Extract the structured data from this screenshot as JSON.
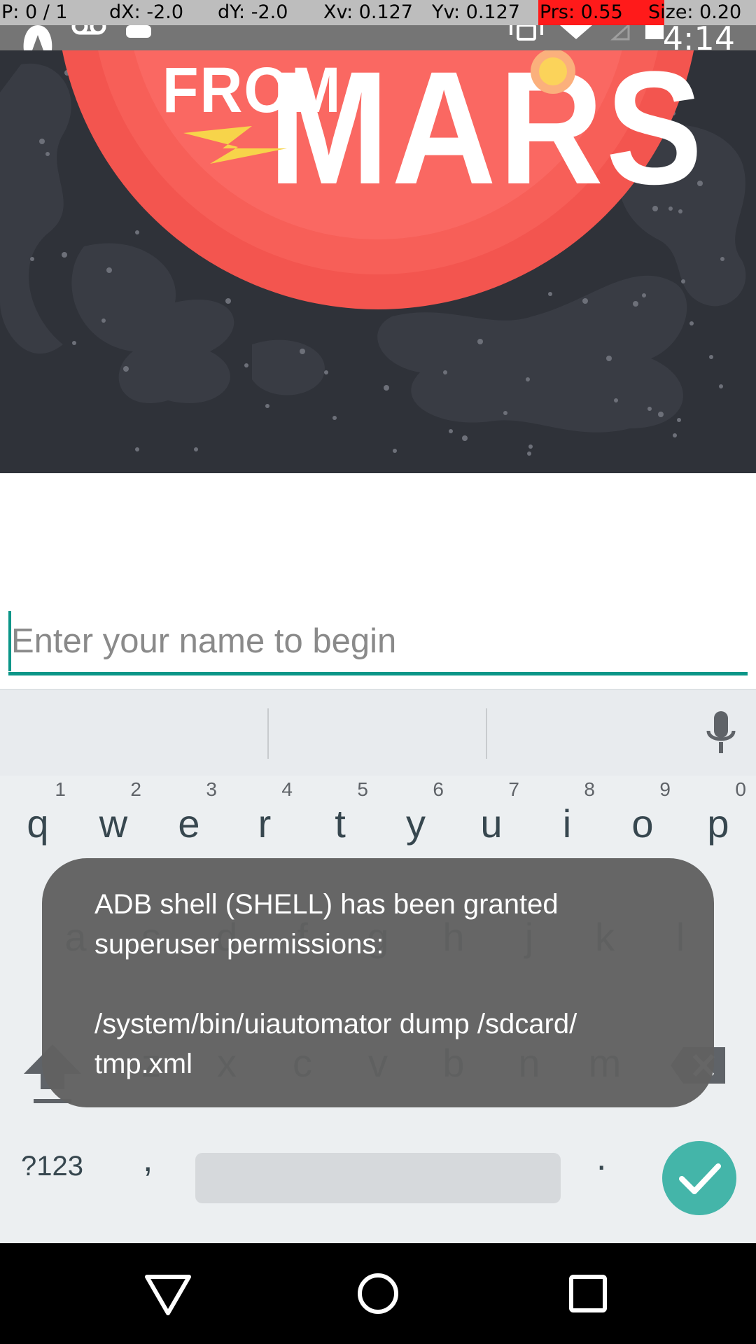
{
  "debug_overlay": {
    "pointer": "P: 0 / 1",
    "dx": "dX: -2.0",
    "dy": "dY: -2.0",
    "xv": "Xv: 0.127",
    "yv": "Yv: 0.127",
    "pressure": "Prs: 0.55",
    "size": "Size: 0.20"
  },
  "status_bar": {
    "time": "4:14",
    "icons": [
      "app-notification-icon",
      "voicemail-icon",
      "android-icon",
      "vibrate-icon",
      "wifi-icon",
      "cell-signal-icon",
      "battery-charging-icon"
    ]
  },
  "hero": {
    "logo_text_small": "FROM",
    "logo_text_large": "MARS"
  },
  "name_input": {
    "placeholder": "Enter your name to begin",
    "value": ""
  },
  "keyboard": {
    "row1": [
      {
        "key": "q",
        "hint": "1"
      },
      {
        "key": "w",
        "hint": "2"
      },
      {
        "key": "e",
        "hint": "3"
      },
      {
        "key": "r",
        "hint": "4"
      },
      {
        "key": "t",
        "hint": "5"
      },
      {
        "key": "y",
        "hint": "6"
      },
      {
        "key": "u",
        "hint": "7"
      },
      {
        "key": "i",
        "hint": "8"
      },
      {
        "key": "o",
        "hint": "9"
      },
      {
        "key": "p",
        "hint": "0"
      }
    ],
    "row2": [
      "a",
      "s",
      "d",
      "f",
      "g",
      "h",
      "j",
      "k",
      "l"
    ],
    "row3": [
      "z",
      "x",
      "c",
      "v",
      "b",
      "n",
      "m"
    ],
    "symbols_label": "?123",
    "comma_label": ",",
    "period_label": ".",
    "enter_icon": "check-icon",
    "colors": {
      "accent": "#44b5a9",
      "input_underline": "#0b9688"
    }
  },
  "toast": {
    "message": "ADB shell (SHELL) has been granted superuser permissions:\n\n/system/bin/uiautomator dump /sdcard/\ntmp.xml"
  },
  "nav_bar": {
    "buttons": [
      "back-icon",
      "home-icon",
      "recents-icon"
    ]
  }
}
